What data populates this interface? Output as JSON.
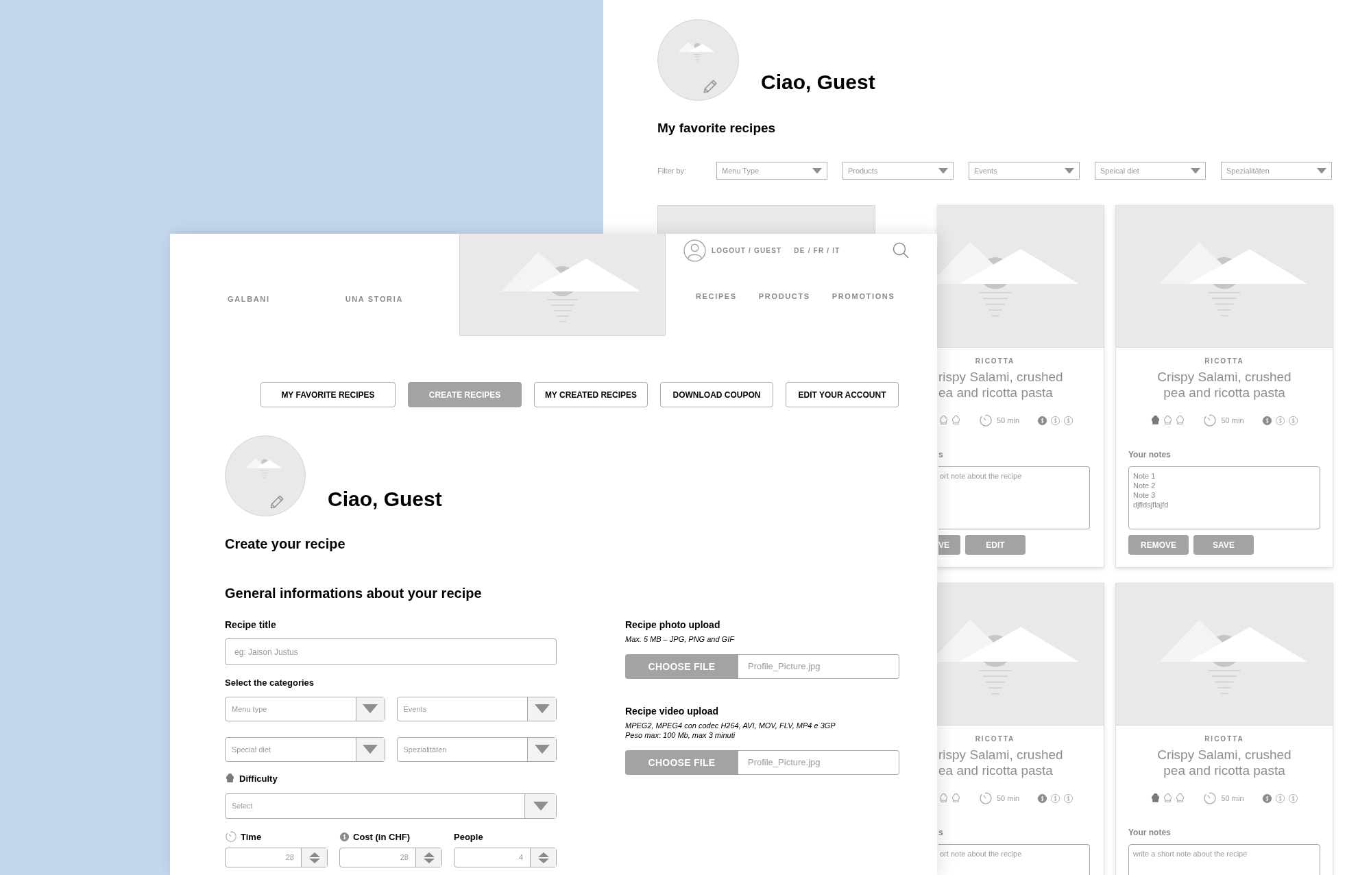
{
  "back_page": {
    "greeting": "Ciao, Guest",
    "heading": "My favorite recipes",
    "filter_label": "Filter by:",
    "filters": [
      {
        "placeholder": "Menu Type"
      },
      {
        "placeholder": "Products"
      },
      {
        "placeholder": "Events"
      },
      {
        "placeholder": "Speical diet"
      },
      {
        "placeholder": "Spezialitäten"
      }
    ],
    "card_rows": [
      [
        {
          "kind": "picture"
        },
        {
          "kind": "cut",
          "category": "RICOTTA",
          "title": "rispy Salami, crushed\nea and ricotta pasta",
          "hats": [
            false,
            false
          ],
          "time": "50 min",
          "coins": [
            true,
            false,
            false
          ],
          "notes_label": "s",
          "notes_placeholder": "ort note about the recipe",
          "buttons": [
            "VE",
            "EDIT"
          ]
        },
        {
          "kind": "full",
          "category": "RICOTTA",
          "title": "Crispy Salami, crushed\npea and ricotta pasta",
          "hats": [
            true,
            false,
            false
          ],
          "time": "50 min",
          "coins": [
            true,
            false,
            false
          ],
          "notes_label": "Your notes",
          "notes": "Note 1\nNote 2\nNote 3\ndjfldsjflajfd",
          "buttons": [
            "REMOVE",
            "SAVE"
          ]
        }
      ],
      [
        {
          "kind": "cut",
          "category": "RICOTTA",
          "title": "rispy Salami, crushed\nea and ricotta pasta",
          "hats": [
            false,
            false
          ],
          "time": "50 min",
          "coins": [
            true,
            false,
            false
          ],
          "notes_label": "s",
          "notes_placeholder": "ort note about the recipe"
        },
        {
          "kind": "full",
          "category": "RICOTTA",
          "title": "Crispy Salami, crushed\npea and ricotta pasta",
          "hats": [
            true,
            false,
            false
          ],
          "time": "50 min",
          "coins": [
            true,
            false,
            false
          ],
          "notes_label": "Your notes",
          "notes_placeholder": "write a short note about the recipe"
        }
      ]
    ]
  },
  "front_page": {
    "nav_left": [
      "GALBANI",
      "UNA STORIA"
    ],
    "account_link": "LOGOUT / GUEST",
    "languages": "DE / FR / IT",
    "nav_right": [
      "RECIPES",
      "PRODUCTS",
      "PROMOTIONS"
    ],
    "tabs": [
      {
        "label": "MY FAVORITE RECIPES",
        "selected": false
      },
      {
        "label": "CREATE RECIPES",
        "selected": true
      },
      {
        "label": "MY CREATED RECIPES",
        "selected": false
      },
      {
        "label": "DOWNLOAD COUPON",
        "selected": false
      },
      {
        "label": "EDIT YOUR ACCOUNT",
        "selected": false
      }
    ],
    "greeting": "Ciao, Guest",
    "page_heading": "Create your recipe",
    "section_heading": "General informations about your recipe",
    "recipe_title": {
      "label": "Recipe title",
      "placeholder": "eg: Jaison Justus"
    },
    "categories": {
      "label": "Select the categories",
      "selects": [
        {
          "placeholder": "Menu type"
        },
        {
          "placeholder": "Events"
        },
        {
          "placeholder": "Special diet"
        },
        {
          "placeholder": "Spezialitäten"
        }
      ]
    },
    "difficulty": {
      "label": "Difficulty",
      "placeholder": "Select"
    },
    "numbers": [
      {
        "kind": "time",
        "label": "Time",
        "value": "28"
      },
      {
        "kind": "cost",
        "label": "Cost (in CHF)",
        "value": "28"
      },
      {
        "kind": "people",
        "label": "People",
        "value": "4"
      }
    ],
    "uploads": [
      {
        "label": "Recipe photo upload",
        "hints": [
          "Max. 5 MB – JPG, PNG and GIF"
        ],
        "button": "CHOOSE FILE",
        "file": "Profile_Picture.jpg"
      },
      {
        "label": "Recipe video upload",
        "hints": [
          "MPEG2, MPEG4 con codec H264, AVI, MOV, FLV, MP4 e 3GP",
          "Peso max: 100 Mb, max 3 minuti"
        ],
        "button": "CHOOSE FILE",
        "file": "Profile_Picture.jpg"
      }
    ]
  }
}
